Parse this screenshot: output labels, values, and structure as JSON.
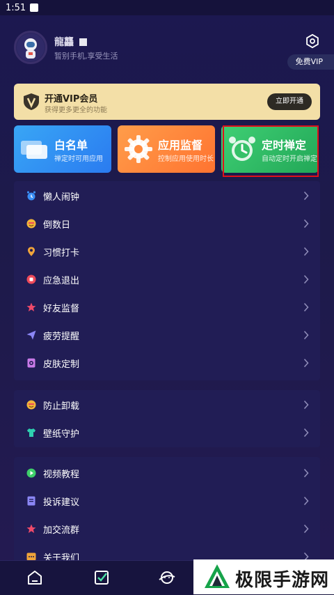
{
  "status_bar": {
    "time": "1:51"
  },
  "profile": {
    "username": "龍龘",
    "tagline": "暂别手机,享受生活",
    "vip_free_label": "免费VIP"
  },
  "vip_banner": {
    "title": "开通VIP会员",
    "subtitle": "获得更多更全的功能",
    "button": "立即开通"
  },
  "cards": [
    {
      "title": "白名单",
      "subtitle": "禅定时可用应用"
    },
    {
      "title": "应用监督",
      "subtitle": "控制应用使用时长"
    },
    {
      "title": "定时禅定",
      "subtitle": "自动定时开启禅定"
    }
  ],
  "menu_group_1": [
    {
      "label": "懒人闹钟",
      "icon": "alarm-clock-icon",
      "color": "#3a8ef5"
    },
    {
      "label": "倒数日",
      "icon": "smiley-icon",
      "color": "#f2b63a"
    },
    {
      "label": "习惯打卡",
      "icon": "location-pin-icon",
      "color": "#f0a43a"
    },
    {
      "label": "应急退出",
      "icon": "stop-icon",
      "color": "#ef4a5a"
    },
    {
      "label": "好友监督",
      "icon": "star-icon",
      "color": "#ef4a6a"
    },
    {
      "label": "疲劳提醒",
      "icon": "paper-plane-icon",
      "color": "#8b86f5"
    },
    {
      "label": "皮肤定制",
      "icon": "skin-icon",
      "color": "#c97ae8"
    }
  ],
  "menu_group_2": [
    {
      "label": "防止卸载",
      "icon": "smiley-icon",
      "color": "#f2b63a"
    },
    {
      "label": "壁纸守护",
      "icon": "shirt-icon",
      "color": "#2fd0b0"
    }
  ],
  "menu_group_3": [
    {
      "label": "视频教程",
      "icon": "play-icon",
      "color": "#3ecf6a"
    },
    {
      "label": "投诉建议",
      "icon": "document-icon",
      "color": "#8b86f5"
    },
    {
      "label": "加交流群",
      "icon": "star-icon",
      "color": "#ef4a6a"
    },
    {
      "label": "关于我们",
      "icon": "info-icon",
      "color": "#f0a43a"
    }
  ],
  "watermark": {
    "text": "极限手游网"
  }
}
